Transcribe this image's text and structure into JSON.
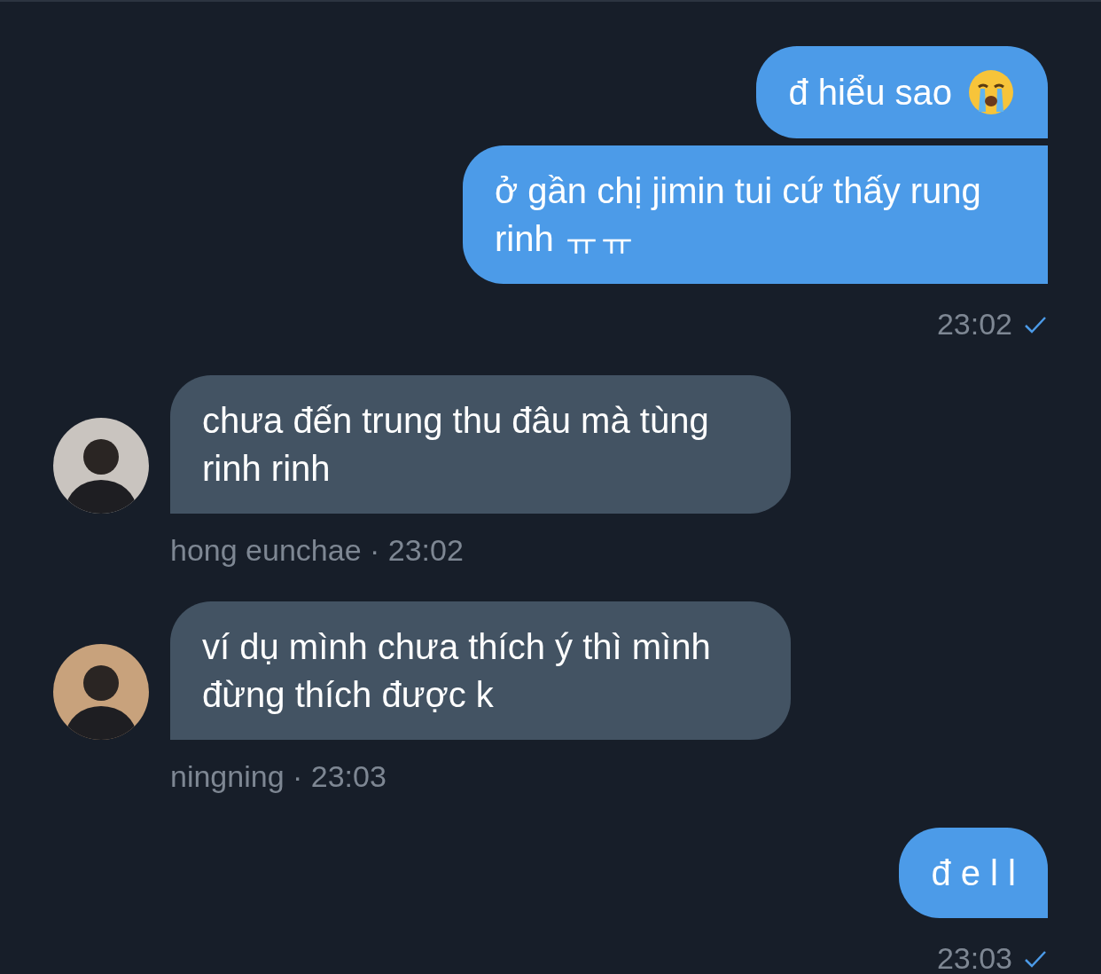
{
  "messages": [
    {
      "kind": "sent",
      "text": "đ hiểu sao",
      "has_emoji": true
    },
    {
      "kind": "sent",
      "text": "ở gần chị jimin tui cứ thấy rung rinh ㅠㅠ",
      "time": "23:02",
      "read": true
    },
    {
      "kind": "received",
      "text": "chưa đến trung thu đâu mà tùng rinh rinh",
      "meta": "hong eunchae · 23:02"
    },
    {
      "kind": "received",
      "text": "ví dụ mình chưa thích ý thì mình đừng thích được k",
      "meta": "ningning · 23:03"
    },
    {
      "kind": "sent",
      "text": "đ e l l",
      "time": "23:03",
      "read": true
    }
  ]
}
